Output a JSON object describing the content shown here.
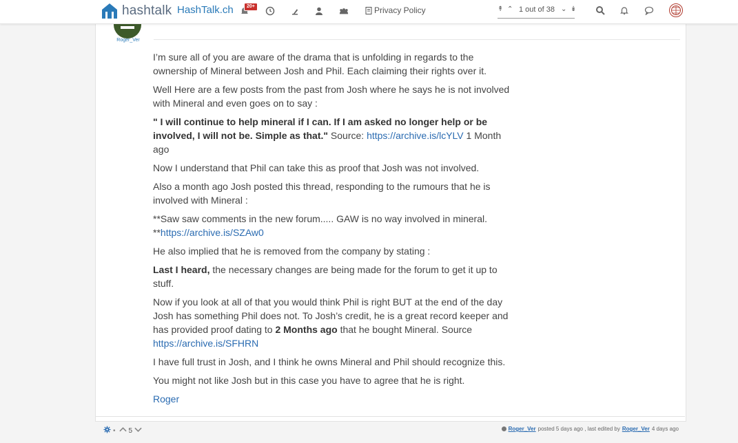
{
  "header": {
    "logo_text": "hashtalk",
    "site_title": "HashTalk.ch",
    "badge": "20+",
    "privacy_label": "Privacy Policy",
    "pagination": "1 out of 38"
  },
  "post": {
    "author": "Roger_Ver",
    "paragraphs": [
      {
        "text": "I’m sure all of you are aware of the drama that is unfolding in regards to the ownership of Mineral between Josh and Phil. Each claiming their rights over it."
      },
      {
        "text": "Well Here are a few posts from the past from Josh where he says he is not involved with Mineral and even goes on to say :"
      },
      {
        "bold": "\" I will continue to help mineral if I can. If I am asked no longer help or be involved, I will not be. Simple as that.\"",
        "text": " Source: ",
        "link": "https://archive.is/lcYLV",
        "after": " 1 Month ago"
      },
      {
        "text": "Now I understand that Phil can take this as proof that Josh was not involved."
      },
      {
        "text": "Also a month ago Josh posted this thread, responding to the rumours that he is involved with Mineral :"
      },
      {
        "text": "**Saw saw comments in the new forum..... GAW is no way involved in mineral. **",
        "link": "https://archive.is/SZAw0"
      },
      {
        "text": "He also implied that he is removed from the company by stating :"
      },
      {
        "bold": "Last I heard,",
        "text": " the necessary changes are being made for the forum to get it up to stuff."
      },
      {
        "text": "Now if you look at all of that you would think Phil is right BUT at the end of the day Josh has something Phil does not. To Josh’s credit, he is a great record keeper and has provided proof dating to ",
        "bold_mid": "2 Months ago",
        "text2": " that he bought Mineral. Source ",
        "link": "https://archive.is/SFHRN"
      },
      {
        "text": "I have full trust in Josh, and I think he owns Mineral and Phil should recognize this."
      },
      {
        "text": "You might not like Josh but in this case you have to agree that he is right."
      },
      {
        "link": "Roger"
      }
    ]
  },
  "footer": {
    "votes": "5",
    "posted_by": "Roger_Ver",
    "posted_text": "posted 5 days ago , last edited by",
    "edited_by": "Roger_Ver",
    "edited_text": "4 days ago"
  },
  "colors": {
    "link": "#2a6bb1",
    "badge": "#c9302c"
  }
}
